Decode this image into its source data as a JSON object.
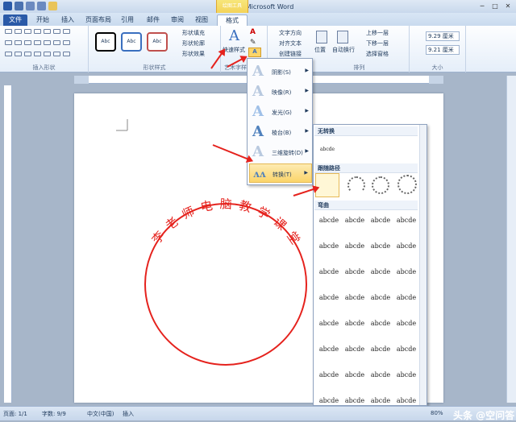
{
  "window": {
    "title": "文档1 - Microsoft Word",
    "context_tab_header": "绘图工具"
  },
  "tabs": [
    "文件",
    "开始",
    "插入",
    "页面布局",
    "引用",
    "邮件",
    "审阅",
    "视图",
    "格式"
  ],
  "ribbon": {
    "insert_shapes_label": "插入形状",
    "shape_styles_label": "形状样式",
    "style_box_text": "Abc",
    "shape_fill": "形状填充",
    "shape_outline": "形状轮廓",
    "shape_effects": "形状效果",
    "quick_styles": "快速样式",
    "wordart_label": "艺术字样",
    "text_direction": "文字方向",
    "align_text": "对齐文本",
    "create_link": "创建链接",
    "position": "位置",
    "auto_wrap": "自动换行",
    "bring_forward": "上移一层",
    "send_backward": "下移一层",
    "selection_pane": "选择窗格",
    "arrange_label": "排列",
    "height": "9.29 厘米",
    "width": "9.21 厘米",
    "size_label": "大小"
  },
  "effects_menu": [
    {
      "label": "阴影(S)"
    },
    {
      "label": "映像(R)"
    },
    {
      "label": "发光(G)"
    },
    {
      "label": "棱台(B)"
    },
    {
      "label": "三维旋转(D)"
    },
    {
      "label": "转换(T)"
    }
  ],
  "transform_panel": {
    "no_transform": "无转换",
    "no_transform_sample": "abcde",
    "follow_path": "跟随路径",
    "warp": "弯曲",
    "sample": "abcde"
  },
  "stamp": {
    "text": "李老师电脑教学课堂",
    "color": "#e5221d"
  },
  "status": {
    "page": "页面: 1/1",
    "words": "字数: 9/9",
    "language": "中文(中国)",
    "mode": "插入",
    "zoom": "80%"
  },
  "watermark": "头条 @空问答"
}
